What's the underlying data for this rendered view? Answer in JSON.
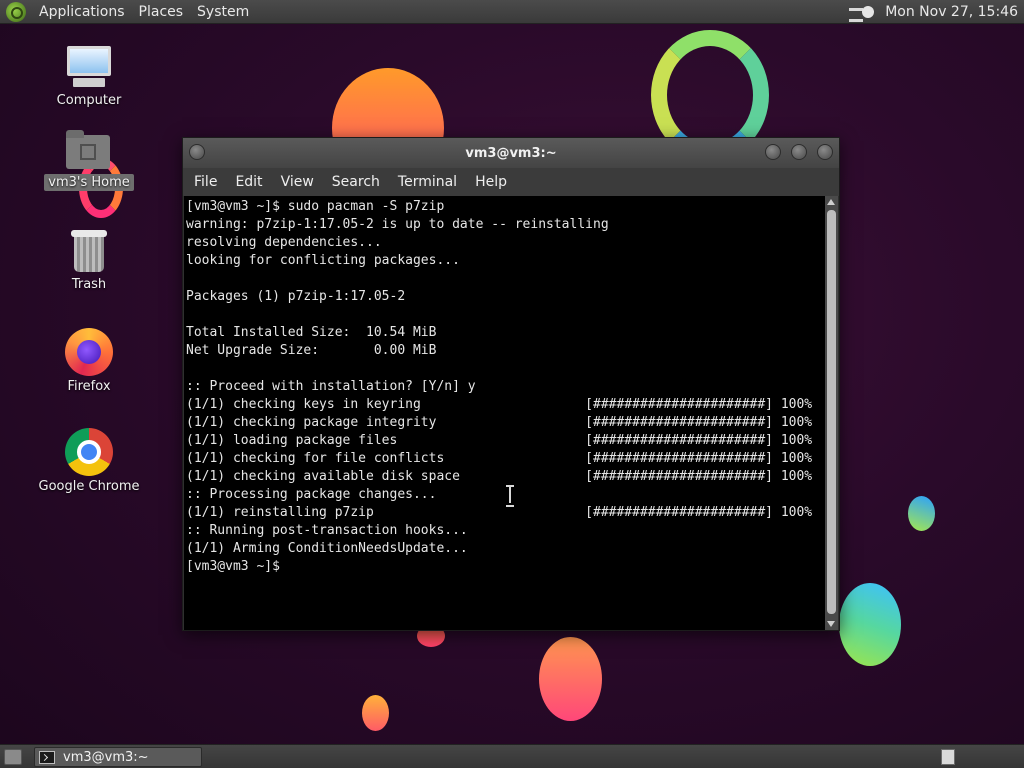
{
  "top_panel": {
    "menus": [
      "Applications",
      "Places",
      "System"
    ],
    "clock": "Mon Nov 27, 15:46",
    "icons": {
      "logo": "mate-logo-icon",
      "network": "network-wired-icon"
    }
  },
  "desktop": {
    "icons": [
      {
        "label": "Computer",
        "icon": "computer-icon"
      },
      {
        "label": "vm3's Home",
        "icon": "home-folder-icon"
      },
      {
        "label": "Trash",
        "icon": "trash-icon"
      },
      {
        "label": "Firefox",
        "icon": "firefox-icon"
      },
      {
        "label": "Google Chrome",
        "icon": "chrome-icon"
      }
    ]
  },
  "window": {
    "title": "vm3@vm3:~",
    "menu": [
      "File",
      "Edit",
      "View",
      "Search",
      "Terminal",
      "Help"
    ],
    "terminal_lines": [
      "[vm3@vm3 ~]$ sudo pacman -S p7zip",
      "warning: p7zip-1:17.05-2 is up to date -- reinstalling",
      "resolving dependencies...",
      "looking for conflicting packages...",
      "",
      "Packages (1) p7zip-1:17.05-2",
      "",
      "Total Installed Size:  10.54 MiB",
      "Net Upgrade Size:       0.00 MiB",
      "",
      ":: Proceed with installation? [Y/n] y",
      "(1/1) checking keys in keyring                     [######################] 100%",
      "(1/1) checking package integrity                   [######################] 100%",
      "(1/1) loading package files                        [######################] 100%",
      "(1/1) checking for file conflicts                  [######################] 100%",
      "(1/1) checking available disk space                [######################] 100%",
      ":: Processing package changes...",
      "(1/1) reinstalling p7zip                           [######################] 100%",
      ":: Running post-transaction hooks...",
      "(1/1) Arming ConditionNeedsUpdate...",
      "[vm3@vm3 ~]$"
    ]
  },
  "bottom_panel": {
    "task_label": "vm3@vm3:~"
  },
  "colors": {
    "desktop_bg": "#2a0a2a",
    "panel_bg": "#3f3f3f",
    "terminal_bg": "#000000",
    "terminal_fg": "#e6e6e6"
  }
}
